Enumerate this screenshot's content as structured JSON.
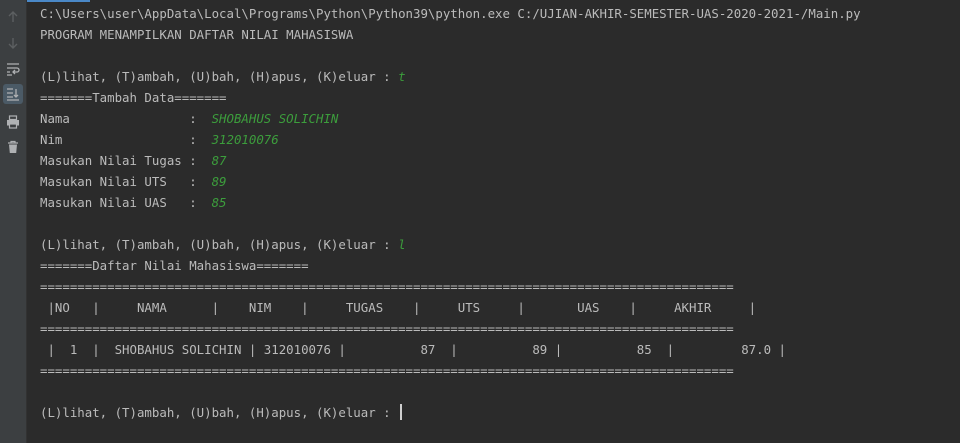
{
  "gutter": {
    "icons": [
      "arrow-up-icon",
      "arrow-down-icon",
      "soft-wrap-icon",
      "scroll-to-end-icon",
      "print-icon",
      "trash-icon"
    ]
  },
  "console": {
    "lines": [
      {
        "text": "C:\\Users\\user\\AppData\\Local\\Programs\\Python\\Python39\\python.exe C:/UJIAN-AKHIR-SEMESTER-UAS-2020-2021-/Main.py",
        "input": ""
      },
      {
        "text": "PROGRAM MENAMPILKAN DAFTAR NILAI MAHASISWA",
        "input": ""
      },
      {
        "text": "",
        "input": ""
      },
      {
        "text": "(L)lihat, (T)ambah, (U)bah, (H)apus, (K)eluar : ",
        "input": "t"
      },
      {
        "text": "=======Tambah Data=======",
        "input": ""
      },
      {
        "text": "Nama                :  ",
        "input": "SHOBAHUS SOLICHIN"
      },
      {
        "text": "Nim                 :  ",
        "input": "312010076"
      },
      {
        "text": "Masukan Nilai Tugas :  ",
        "input": "87"
      },
      {
        "text": "Masukan Nilai UTS   :  ",
        "input": "89"
      },
      {
        "text": "Masukan Nilai UAS   :  ",
        "input": "85"
      },
      {
        "text": "",
        "input": ""
      },
      {
        "text": "(L)lihat, (T)ambah, (U)bah, (H)apus, (K)eluar : ",
        "input": "l"
      },
      {
        "text": "=======Daftar Nilai Mahasiswa=======",
        "input": ""
      },
      {
        "text": "=============================================================================================",
        "input": ""
      },
      {
        "text": " |NO   |     NAMA      |    NIM    |     TUGAS    |     UTS     |       UAS    |     AKHIR     |",
        "input": ""
      },
      {
        "text": "=============================================================================================",
        "input": ""
      },
      {
        "text": " |  1  |  SHOBAHUS SOLICHIN | 312010076 |          87  |          89 |          85  |         87.0 |",
        "input": ""
      },
      {
        "text": "=============================================================================================",
        "input": ""
      },
      {
        "text": "",
        "input": ""
      },
      {
        "text": "(L)lihat, (T)ambah, (U)bah, (H)apus, (K)eluar : ",
        "input": ""
      }
    ]
  }
}
